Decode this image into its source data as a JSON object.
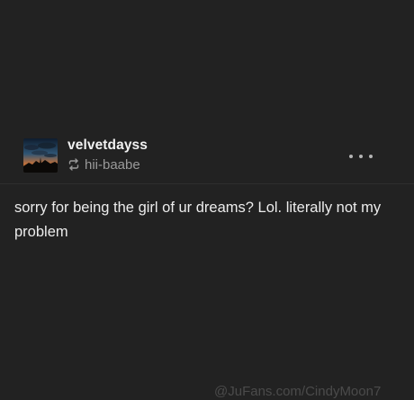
{
  "post": {
    "blog_name": "velvetdayss",
    "reblogged_from": "hii-baabe",
    "body_text": "sorry for being the girl of ur dreams? Lol. literally not my problem",
    "more_icon": "ellipsis-icon",
    "reblog_icon": "reblog-icon"
  },
  "watermark": {
    "text": "@JuFans.com/CindyMoon7"
  },
  "colors": {
    "background": "#222222",
    "text_primary": "#f2f2f2",
    "text_secondary": "#9a9a9a"
  }
}
